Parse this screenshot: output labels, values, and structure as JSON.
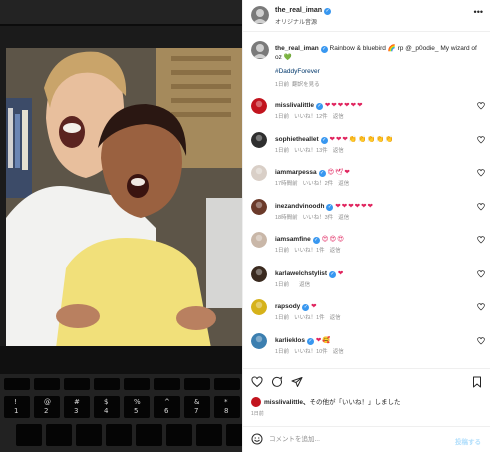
{
  "post": {
    "username": "the_real_iman",
    "audio": "オリジナル音源",
    "more_icon": "more-horizontal-icon"
  },
  "caption": {
    "username": "the_real_iman",
    "text": "Rainbow & bluebird 🌈 rp @_p0odie_ My wizard of oz",
    "emoji": "💚",
    "hashtag": "#DaddyForever",
    "time": "1日前",
    "translate": "翻訳を見る"
  },
  "comments": [
    {
      "user": "misslivalittle",
      "text": "❤❤❤❤❤❤",
      "time": "1日前",
      "likes": "いいね！12件",
      "reply": "返信",
      "avatar_color": "#c2141e"
    },
    {
      "user": "sophietheallet",
      "text": "❤❤❤👏👏👏👏👏",
      "time": "1日前",
      "likes": "いいね！13件",
      "reply": "返信",
      "avatar_color": "#2f2f2f"
    },
    {
      "user": "iammarpessa",
      "text": "😍🕊❤",
      "time": "17時間前",
      "likes": "いいね！2件",
      "reply": "返信",
      "avatar_color": "#d9cfc7"
    },
    {
      "user": "inezandvinoodh",
      "text": "❤❤❤❤❤❤",
      "time": "18時間前",
      "likes": "いいね！3件",
      "reply": "返信",
      "avatar_color": "#6b3a2a"
    },
    {
      "user": "iamsamfine",
      "text": "😍😍😍",
      "time": "1日前",
      "likes": "いいね！1件",
      "reply": "返信",
      "avatar_color": "#c9b7a8"
    },
    {
      "user": "karlawelchstylist",
      "text": "❤",
      "time": "1日前",
      "likes": "",
      "reply": "返信",
      "avatar_color": "#3a2a1f"
    },
    {
      "user": "rapsody",
      "text": "❤",
      "time": "1日前",
      "likes": "いいね！1件",
      "reply": "返信",
      "avatar_color": "#d6b21a"
    },
    {
      "user": "karlieklos",
      "text": "❤🥰",
      "time": "1日前",
      "likes": "いいね！10件",
      "reply": "返信",
      "avatar_color": "#3c7fb0"
    }
  ],
  "actions": {
    "like_icon": "heart-icon",
    "comment_icon": "comment-icon",
    "share_icon": "send-icon",
    "save_icon": "bookmark-icon"
  },
  "liked_by": {
    "user": "misslivalittle",
    "suffix": "その他が「いいね！」しました"
  },
  "post_time": "1日前",
  "add_comment": {
    "placeholder": "コメントを追加...",
    "post_label": "投稿する",
    "emoji_icon": "smile-icon"
  },
  "keyboard": {
    "keys": [
      "!",
      "@",
      "#",
      "$",
      "%",
      "^",
      "&",
      "*"
    ],
    "numbers": [
      "1",
      "2",
      "3",
      "4",
      "5",
      "6",
      "7",
      "8"
    ]
  },
  "colors": {
    "verified": "#3897f0",
    "heart": "#e0245e",
    "link": "#00376b",
    "muted": "#8e8e8e"
  }
}
